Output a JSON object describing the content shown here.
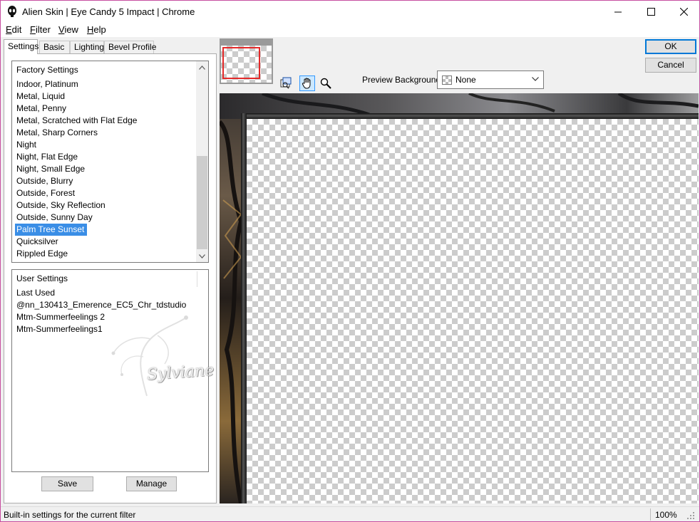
{
  "window": {
    "title": "Alien Skin | Eye Candy 5 Impact | Chrome",
    "border_color": "#c74ea0"
  },
  "menu": [
    {
      "first": "E",
      "rest": "dit"
    },
    {
      "first": "F",
      "rest": "ilter"
    },
    {
      "first": "V",
      "rest": "iew"
    },
    {
      "first": "H",
      "rest": "elp"
    }
  ],
  "tabs": [
    "Settings",
    "Basic",
    "Lighting",
    "Bevel Profile"
  ],
  "factory_settings": {
    "header": "Factory Settings",
    "items": [
      "Indoor, Platinum",
      "Metal, Liquid",
      "Metal, Penny",
      "Metal, Scratched with Flat Edge",
      "Metal, Sharp Corners",
      "Night",
      "Night, Flat Edge",
      "Night, Small Edge",
      "Outside, Blurry",
      "Outside, Forest",
      "Outside, Sky Reflection",
      "Outside, Sunny Day",
      "Palm Tree Sunset",
      "Quicksilver",
      "Rippled Edge"
    ],
    "selected": "Palm Tree Sunset",
    "selection_color": "#3a8ee6"
  },
  "user_settings": {
    "header": "User Settings",
    "items": [
      "Last Used",
      "@nn_130413_Emerence_EC5_Chr_tdstudio",
      "Mtm-Summerfeelings 2",
      "Mtm-Summerfeelings1"
    ]
  },
  "buttons": {
    "save": "Save",
    "manage": "Manage",
    "ok": "OK",
    "cancel": "Cancel"
  },
  "toolbar": {
    "preview_background_label": "Preview Background:",
    "preview_background_value": "None",
    "tools": [
      "navigator-icon",
      "hand-icon",
      "zoom-icon"
    ],
    "active_tool": "hand-icon"
  },
  "watermark": "Sylviane",
  "status": {
    "text": "Built-in settings for the current filter",
    "zoom": "100%"
  }
}
